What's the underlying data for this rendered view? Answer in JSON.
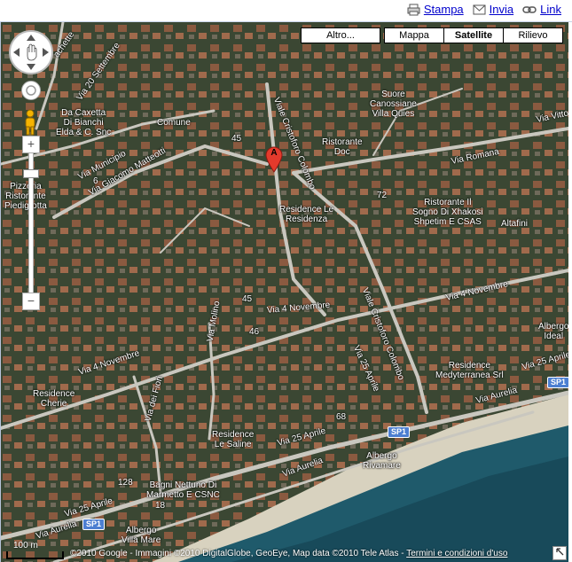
{
  "toolbar": {
    "print_label": "Stampa",
    "send_label": "Invia",
    "link_label": "Link"
  },
  "map_types": {
    "more": "Altro...",
    "map": "Mappa",
    "satellite": "Satellite",
    "relief": "Rilievo",
    "active": "Satellite"
  },
  "marker": {
    "letter": "A"
  },
  "places": {
    "caxetta": "Da Caxetta\nDi Bianchi\nElda & C. Snc",
    "comune": "Comune",
    "suore": "Suore\nCanossiane\nVilla Quies",
    "ristorante_doc": "Ristorante\nDoc",
    "pizzeria": "Pizzeria\nRistorante\nPiedigrotta",
    "residence_residenza": "Residence Le\nResidenza",
    "xhakosi": "Ristorante Il\nSogno Di Xhakosi\nShpetim E CSAS",
    "altafini": "Altafini",
    "albergo_ideal": "Albergo\nIdeal",
    "residence_cherie": "Residence\nCherie",
    "residence_mediterranea": "Residence\nMedyterranea Srl",
    "residence_saline": "Residence\nLe Saline",
    "albergo_rivamare": "Albergo\nRivamare",
    "bagni_nettuno": "Bagni Nettuno Di\nMarmetto E CSNC",
    "albergo_mare": "Albergo\nVilla Mare"
  },
  "roads": {
    "via_20_settembre": "Via 20 Settembre",
    "via_municipio": "Via Municipio",
    "via_matteotti": "Via Giacomo Matteotti",
    "viale_colombo_top": "Viale Cristoforo Colombo",
    "viale_colombo_bottom": "Viale Cristoforo Colombo",
    "via_romana": "Via Romana",
    "via_vittorio": "Via Vitto",
    "via_4_novembre_left": "Via 4 Novembre",
    "via_4_novembre_mid": "Via 4 Novembre",
    "via_4_novembre_right": "Via 4 Novembre",
    "via_molino": "Via Molino",
    "via_dei_fiori": "Via dei Fiori",
    "via_25_aprile_mid": "Via 25 Aprile",
    "via_25_aprile_left": "Via 25 Aprile",
    "via_25_aprile_right": "Via 25 Aprile",
    "via_25_aprile_diag": "Via 25 Aprile",
    "via_aurelia_right": "Via Aurelia",
    "via_aurelia_mid": "Via Aurelia",
    "via_aurelia_left": "Via Aurelia",
    "vachette": "achette"
  },
  "road_badges": {
    "sp1_right": "SP1",
    "sp1_mid": "SP1",
    "sp1_left": "SP1"
  },
  "house_numbers": [
    "45",
    "6",
    "72",
    "45",
    "46",
    "68",
    "128",
    "18"
  ],
  "scale": {
    "label": "100 m"
  },
  "footer": {
    "copyright": "©2010 Google - Immagini ©2010 DigitalGlobe, GeoEye, Map data ©2010 Tele Atlas - ",
    "terms": "Termini e condizioni d'uso"
  },
  "colors": {
    "land": "#3b4733",
    "sea": "#1f5a6b",
    "beach": "#d8d2bf",
    "road": "#c9c7bf",
    "badge": "#4d7fd1",
    "marker": "#e43a2c"
  }
}
